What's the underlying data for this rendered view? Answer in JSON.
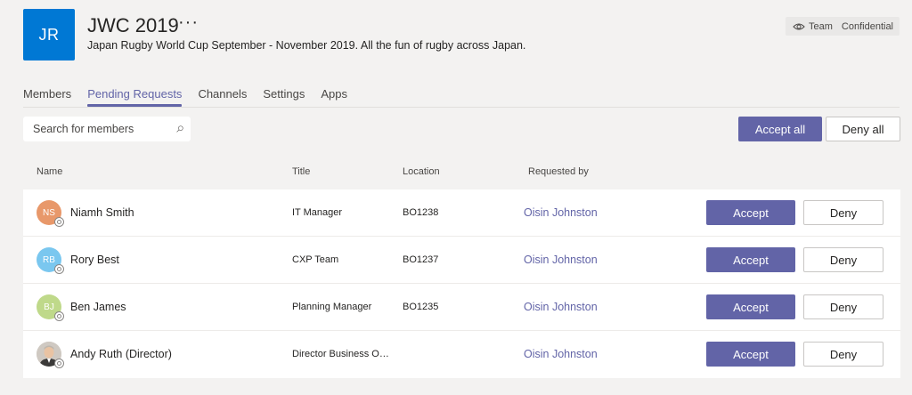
{
  "team": {
    "initials": "JR",
    "tile_color": "#0078d4",
    "name": "JWC 2019",
    "more_icon": "···",
    "description": "Japan Rugby World Cup September - November 2019. All the fun of rugby across Japan.",
    "visibility": "Team",
    "classification": "Confidential"
  },
  "tabs": [
    {
      "label": "Members",
      "active": false
    },
    {
      "label": "Pending Requests",
      "active": true
    },
    {
      "label": "Channels",
      "active": false
    },
    {
      "label": "Settings",
      "active": false
    },
    {
      "label": "Apps",
      "active": false
    }
  ],
  "search": {
    "placeholder": "Search for members",
    "value": ""
  },
  "bulk": {
    "accept_all": "Accept all",
    "deny_all": "Deny all"
  },
  "columns": {
    "name": "Name",
    "title": "Title",
    "location": "Location",
    "requested_by": "Requested by"
  },
  "accent_color": "#6264a7",
  "requests": [
    {
      "initials": "NS",
      "avatar_color": "#e8986a",
      "name": "Niamh Smith",
      "title": "IT Manager",
      "location": "BO1238",
      "requested_by": "Oisin Johnston",
      "accept": "Accept",
      "deny": "Deny"
    },
    {
      "initials": "RB",
      "avatar_color": "#7ac7ef",
      "name": "Rory Best",
      "title": "CXP Team",
      "location": "BO1237",
      "requested_by": "Oisin Johnston",
      "accept": "Accept",
      "deny": "Deny"
    },
    {
      "initials": "BJ",
      "avatar_color": "#bfd98a",
      "name": "Ben James",
      "title": "Planning Manager",
      "location": "BO1235",
      "requested_by": "Oisin Johnston",
      "accept": "Accept",
      "deny": "Deny"
    },
    {
      "initials": "",
      "avatar_color": "#d7d2cc",
      "name": "Andy Ruth (Director)",
      "title": "Director Business Op...",
      "location": "",
      "requested_by": "Oisin Johnston",
      "accept": "Accept",
      "deny": "Deny"
    }
  ]
}
